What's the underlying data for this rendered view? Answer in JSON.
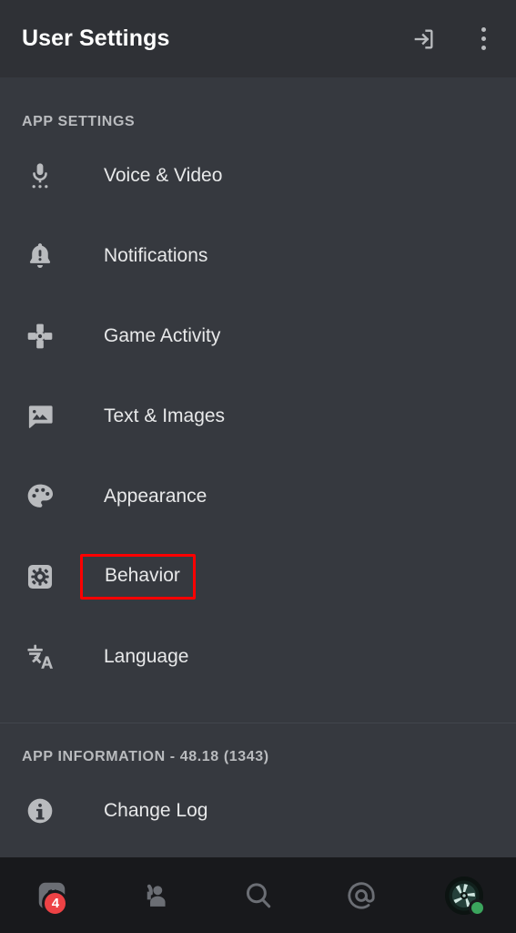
{
  "header": {
    "title": "User Settings",
    "logout_icon": "logout-icon",
    "overflow_icon": "more-vertical-icon"
  },
  "sections": [
    {
      "id": "app-settings",
      "title": "APP SETTINGS",
      "items": [
        {
          "label": "Voice & Video",
          "icon": "microphone-icon"
        },
        {
          "label": "Notifications",
          "icon": "bell-alert-icon"
        },
        {
          "label": "Game Activity",
          "icon": "gamepad-dpad-icon"
        },
        {
          "label": "Text & Images",
          "icon": "image-message-icon"
        },
        {
          "label": "Appearance",
          "icon": "palette-icon"
        },
        {
          "label": "Behavior",
          "icon": "gear-icon",
          "highlighted": true
        },
        {
          "label": "Language",
          "icon": "translate-icon"
        }
      ]
    },
    {
      "id": "app-information",
      "title": "APP INFORMATION - 48.18 (1343)",
      "items": [
        {
          "label": "Change Log",
          "icon": "info-circle-icon"
        }
      ]
    }
  ],
  "bottom_nav": [
    {
      "id": "servers",
      "icon": "discord-servers-icon",
      "badge": "4"
    },
    {
      "id": "friends",
      "icon": "friends-wave-icon"
    },
    {
      "id": "search",
      "icon": "search-icon"
    },
    {
      "id": "mentions",
      "icon": "at-mention-icon"
    },
    {
      "id": "profile",
      "icon": "user-avatar-icon",
      "status": "online"
    }
  ],
  "colors": {
    "background": "#36393f",
    "header_background": "#2f3136",
    "nav_background": "#18191c",
    "highlight_border": "#ff0000",
    "badge": "#ed4245",
    "online": "#3ba55d",
    "icon": "#b9bbbe",
    "text": "#e8e9ea",
    "muted_text": "#b9bbbe"
  }
}
